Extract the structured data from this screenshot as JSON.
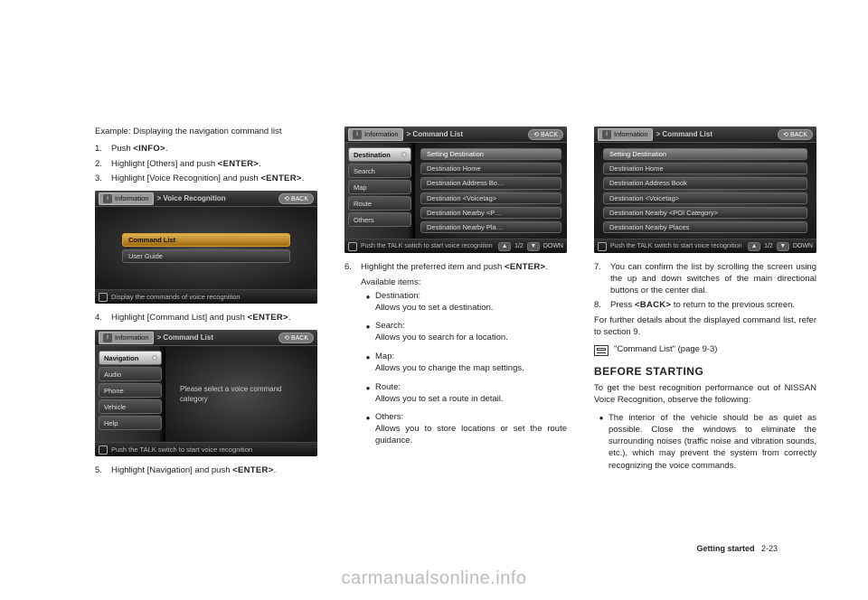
{
  "col1": {
    "example": "Example: Displaying the navigation command list",
    "steps": [
      {
        "num": "1.",
        "pre": "Push ",
        "btn": "<INFO>",
        "post": "."
      },
      {
        "num": "2.",
        "pre": "Highlight [Others] and push ",
        "btn": "<ENTER>",
        "post": "."
      },
      {
        "num": "3.",
        "pre": "Highlight [Voice Recognition] and push ",
        "btn": "<ENTER>",
        "post": "."
      }
    ],
    "shot1": {
      "info_label": "Information",
      "breadcrumb": "> Voice Recognition",
      "back": "BACK",
      "items": [
        "Command List",
        "User Guide"
      ],
      "footer": "Display the commands of voice recognition"
    },
    "step4": {
      "num": "4.",
      "pre": "Highlight [Command List] and push ",
      "btn": "<ENTER>",
      "post": "."
    },
    "shot2": {
      "info_label": "Information",
      "breadcrumb": "> Command List",
      "back": "BACK",
      "left": [
        "Navigation",
        "Audio",
        "Phone",
        "Vehicle",
        "Help"
      ],
      "msg": "Please select a voice command category",
      "footer": "Push the TALK switch to start voice recognition"
    },
    "step5": {
      "num": "5.",
      "pre": "Highlight [Navigation] and push ",
      "btn": "<ENTER>",
      "post": "."
    }
  },
  "col2": {
    "shot3": {
      "info_label": "Information",
      "breadcrumb": "> Command List",
      "back": "BACK",
      "left": [
        "Destination",
        "Search",
        "Map",
        "Route",
        "Others"
      ],
      "right": [
        "Setting Destination",
        "Destination Home",
        "Destination Address Bo…",
        "Destination <Voicetag>",
        "Destination Nearby <P…",
        "Destination Nearby Pla…"
      ],
      "footer": "Push the TALK switch to start voice recognition",
      "page": "1/2",
      "down": "DOWN"
    },
    "step6": {
      "num": "6.",
      "pre": "Highlight the preferred item and push ",
      "btn": "<ENTER>",
      "post": "."
    },
    "avail": "Available items:",
    "items": [
      {
        "t": "Destination:",
        "d": "Allows you to set a destination."
      },
      {
        "t": "Search:",
        "d": "Allows you to search for a location."
      },
      {
        "t": "Map:",
        "d": "Allows you to change the map settings."
      },
      {
        "t": "Route:",
        "d": "Allows you to set a route in detail."
      },
      {
        "t": "Others:",
        "d": "Allows you to store locations or set the route guidance."
      }
    ]
  },
  "col3": {
    "shot4": {
      "info_label": "Information",
      "breadcrumb": "> Command List",
      "back": "BACK",
      "right": [
        "Setting Destination",
        "Destination Home",
        "Destination Address Book",
        "Destination <Voicetag>",
        "Destination Nearby <POI Category>",
        "Destination Nearby Places"
      ],
      "footer": "Push the TALK switch to start voice recognition",
      "page": "1/2",
      "down": "DOWN"
    },
    "step7": {
      "num": "7.",
      "body": "You can confirm the list by scrolling the screen using the up and down switches of the main directional buttons or the center dial."
    },
    "step8": {
      "num": "8.",
      "pre": "Press ",
      "btn": "<BACK>",
      "post": " to return to the previous screen."
    },
    "para1": "For further details about the displayed command list, refer to section 9.",
    "ref": "\"Command List\" (page 9-3)",
    "heading": "BEFORE STARTING",
    "para2": "To get the best recognition performance out of NISSAN Voice Recognition, observe the following:",
    "bullet": "The interior of the vehicle should be as quiet as possible. Close the windows to eliminate the surrounding noises (traffic noise and vibration sounds, etc.), which may prevent the system from correctly recognizing the voice commands."
  },
  "footer": {
    "section": "Getting started",
    "page": "2-23"
  },
  "watermark": "carmanualsonline.info"
}
